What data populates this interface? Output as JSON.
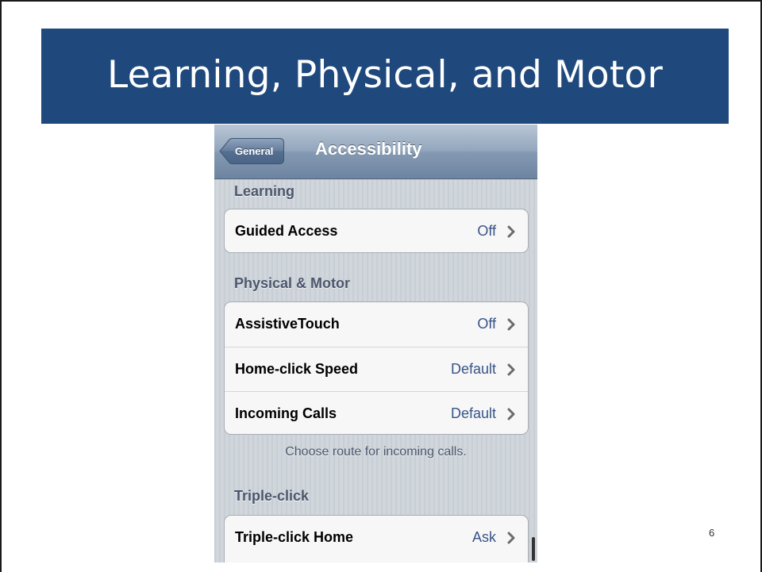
{
  "slide": {
    "title": "Learning, Physical, and Motor",
    "page_number": "6",
    "banner_color": "#1f497d"
  },
  "phone": {
    "navbar": {
      "back_label": "General",
      "title": "Accessibility"
    },
    "sections": [
      {
        "header": "Learning",
        "rows": [
          {
            "label": "Guided Access",
            "value": "Off"
          }
        ]
      },
      {
        "header": "Physical & Motor",
        "rows": [
          {
            "label": "AssistiveTouch",
            "value": "Off"
          },
          {
            "label": "Home-click Speed",
            "value": "Default"
          },
          {
            "label": "Incoming Calls",
            "value": "Default"
          }
        ],
        "footer": "Choose route for incoming calls."
      },
      {
        "header": "Triple-click",
        "rows": [
          {
            "label": "Triple-click Home",
            "value": "Ask"
          }
        ]
      }
    ],
    "colors": {
      "value_text": "#385487",
      "section_header": "#4c566c",
      "navbar": "#7f94ad"
    },
    "icons": {
      "back": "back-arrow-button",
      "disclosure": "chevron-right-icon"
    }
  }
}
